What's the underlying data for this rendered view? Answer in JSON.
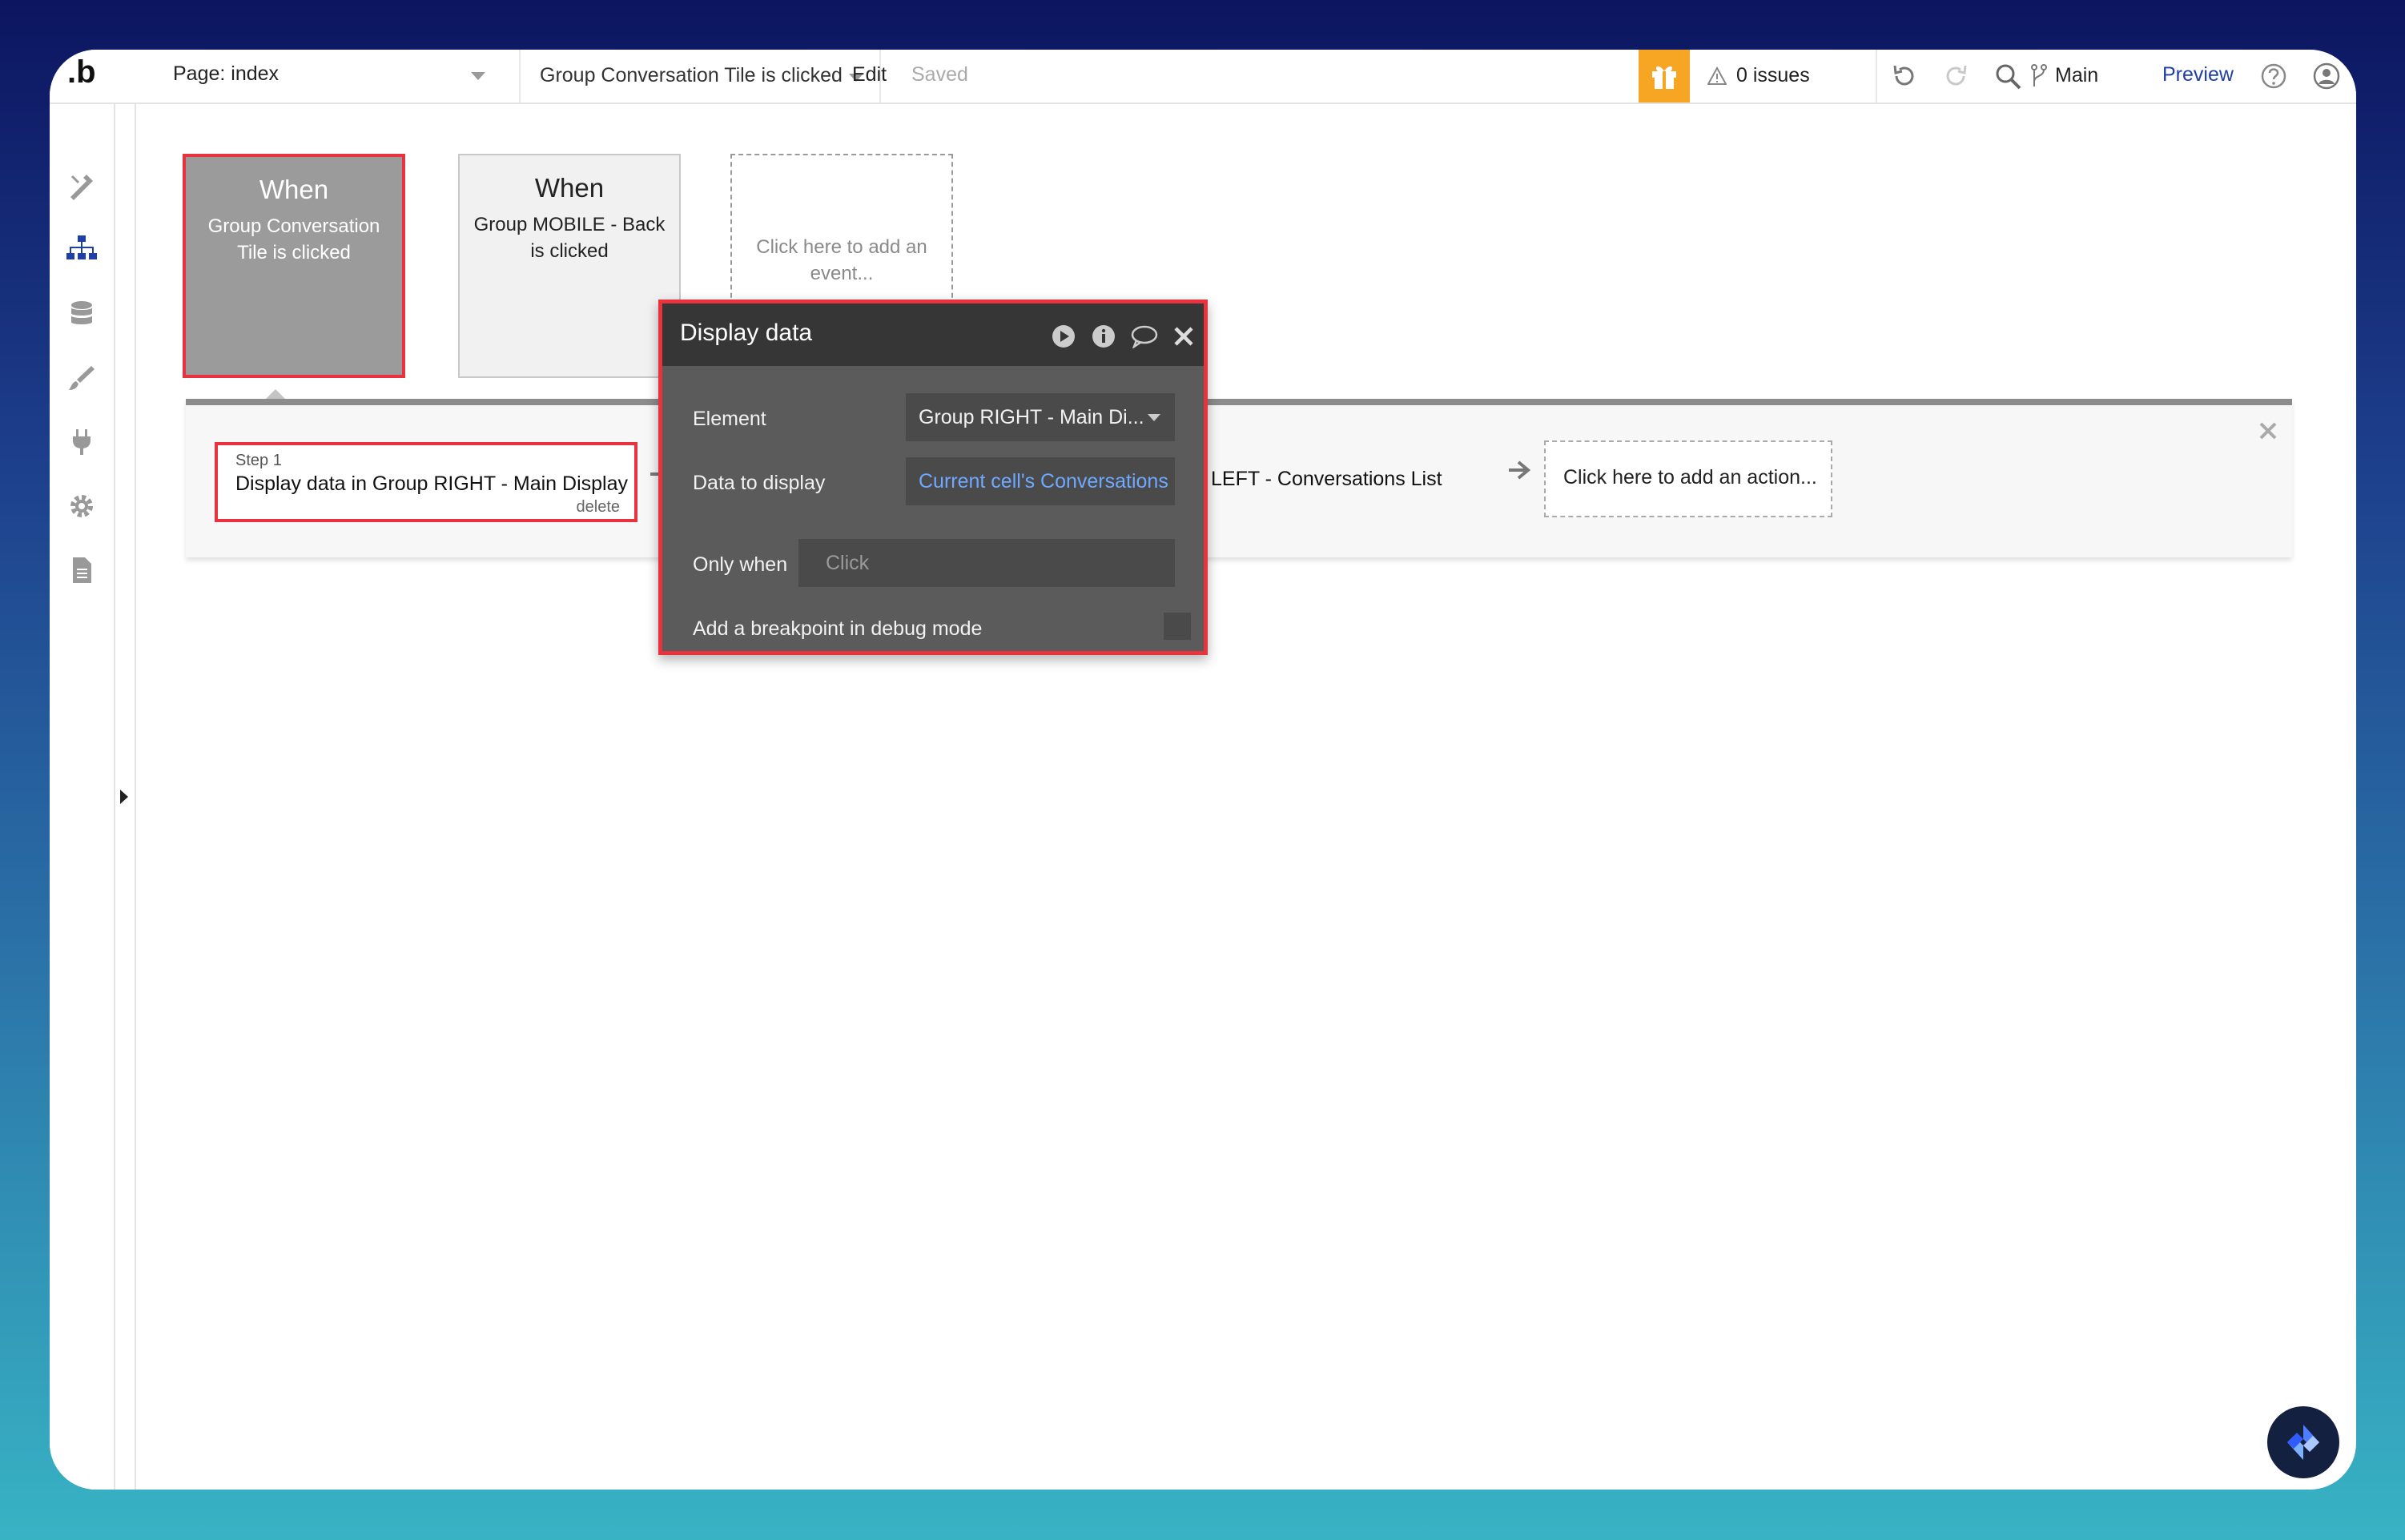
{
  "app": {
    "logo": ".b"
  },
  "topbar": {
    "page_label": "Page: index",
    "event_label": "Group Conversation Tile is clicked",
    "edit_label": "Edit",
    "saved_label": "Saved",
    "issues_label": "0 issues",
    "branch_label": "Main",
    "preview_label": "Preview",
    "icons": [
      "gift-icon",
      "warning-icon",
      "undo-icon",
      "redo-icon",
      "search-icon",
      "branch-icon",
      "help-icon",
      "account-icon"
    ]
  },
  "sidebar": {
    "items": [
      {
        "name": "design-icon"
      },
      {
        "name": "workflow-icon"
      },
      {
        "name": "data-icon"
      },
      {
        "name": "styles-icon"
      },
      {
        "name": "plugins-icon"
      },
      {
        "name": "settings-icon"
      },
      {
        "name": "logs-icon"
      }
    ]
  },
  "events": [
    {
      "when": "When",
      "desc": "Group Conversation Tile is clicked"
    },
    {
      "when": "When",
      "desc": "Group MOBILE - Back is clicked"
    },
    {
      "desc": "Click here to add an event..."
    }
  ],
  "actions": {
    "step1": {
      "number": "Step 1",
      "title": "Display data in Group RIGHT - Main Display",
      "delete": "delete"
    },
    "step2_visible": "LEFT - Conversations List",
    "add_action": "Click here to add an action..."
  },
  "popup": {
    "title": "Display data",
    "element_label": "Element",
    "element_value": "Group RIGHT - Main Di...",
    "data_label": "Data to display",
    "data_value": "Current cell's Conversations",
    "only_when_label": "Only when",
    "only_when_placeholder": "Click",
    "breakpoint_label": "Add a breakpoint in debug mode"
  },
  "colors": {
    "highlight": "#e8333f",
    "gift": "#f6a623",
    "preview_link": "#1f3ea6",
    "dynamic_value": "#6fa8ff",
    "popup_bg": "#5b5b5b",
    "popup_header": "#363636"
  }
}
